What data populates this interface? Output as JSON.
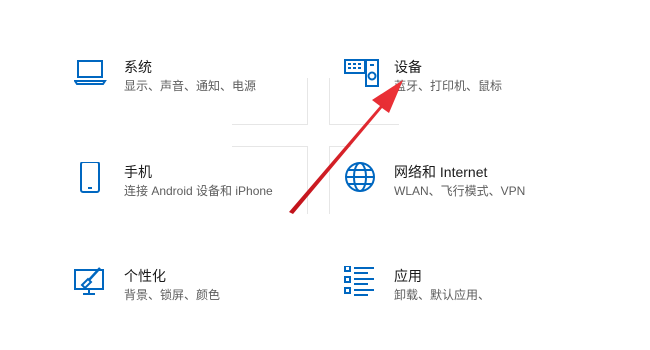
{
  "tiles": [
    {
      "title": "系统",
      "desc": "显示、声音、通知、电源",
      "icon": "laptop-icon"
    },
    {
      "title": "设备",
      "desc": "蓝牙、打印机、鼠标",
      "icon": "devices-icon"
    },
    {
      "title": "手机",
      "desc": "连接 Android 设备和 iPhone",
      "icon": "phone-icon"
    },
    {
      "title": "网络和 Internet",
      "desc": "WLAN、飞行模式、VPN",
      "icon": "globe-icon"
    },
    {
      "title": "个性化",
      "desc": "背景、锁屏、颜色",
      "icon": "personalization-icon"
    },
    {
      "title": "应用",
      "desc": "卸载、默认应用、",
      "icon": "apps-icon"
    }
  ],
  "colors": {
    "accent": "#0067c0",
    "arrow": "#e3212a"
  }
}
